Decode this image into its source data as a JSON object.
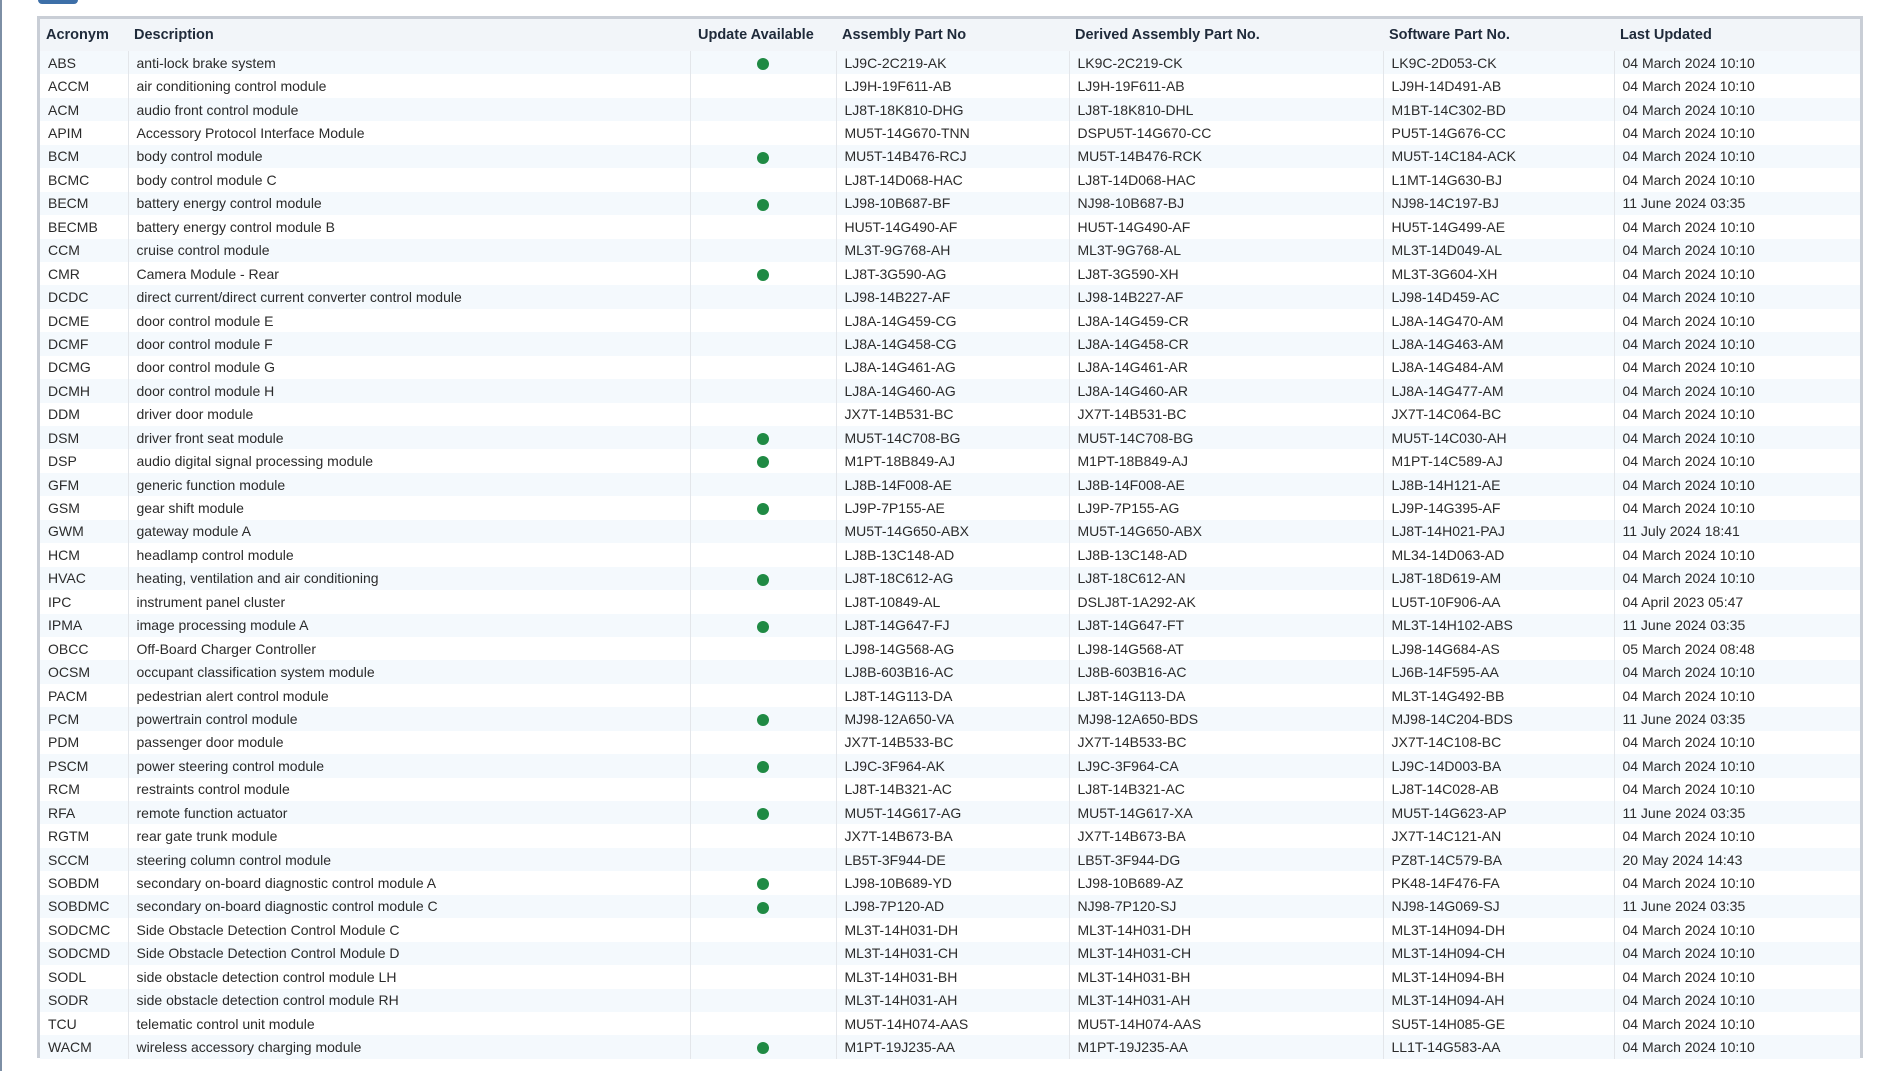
{
  "columns": [
    "Acronym",
    "Description",
    "Update Available",
    "Assembly Part No",
    "Derived Assembly Part No.",
    "Software Part No.",
    "Last Updated"
  ],
  "colors": {
    "update_dot": "#1f8a44",
    "row_stripe": "#f4f9fd",
    "frame": "#c9ced6"
  },
  "rows": [
    {
      "acronym": "ABS",
      "description": "anti-lock brake system",
      "update": true,
      "assembly": "LJ9C-2C219-AK",
      "derived": "LK9C-2C219-CK",
      "software": "LK9C-2D053-CK",
      "updated": "04 March 2024 10:10"
    },
    {
      "acronym": "ACCM",
      "description": "air conditioning control module",
      "update": false,
      "assembly": "LJ9H-19F611-AB",
      "derived": "LJ9H-19F611-AB",
      "software": "LJ9H-14D491-AB",
      "updated": "04 March 2024 10:10"
    },
    {
      "acronym": "ACM",
      "description": "audio front control module",
      "update": false,
      "assembly": "LJ8T-18K810-DHG",
      "derived": "LJ8T-18K810-DHL",
      "software": "M1BT-14C302-BD",
      "updated": "04 March 2024 10:10"
    },
    {
      "acronym": "APIM",
      "description": "Accessory Protocol Interface Module",
      "update": false,
      "assembly": "MU5T-14G670-TNN",
      "derived": "DSPU5T-14G670-CC",
      "software": "PU5T-14G676-CC",
      "updated": "04 March 2024 10:10"
    },
    {
      "acronym": "BCM",
      "description": "body control module",
      "update": true,
      "assembly": "MU5T-14B476-RCJ",
      "derived": "MU5T-14B476-RCK",
      "software": "MU5T-14C184-ACK",
      "updated": "04 March 2024 10:10"
    },
    {
      "acronym": "BCMC",
      "description": "body control module C",
      "update": false,
      "assembly": "LJ8T-14D068-HAC",
      "derived": "LJ8T-14D068-HAC",
      "software": "L1MT-14G630-BJ",
      "updated": "04 March 2024 10:10"
    },
    {
      "acronym": "BECM",
      "description": "battery energy control module",
      "update": true,
      "assembly": "LJ98-10B687-BF",
      "derived": "NJ98-10B687-BJ",
      "software": "NJ98-14C197-BJ",
      "updated": "11 June 2024 03:35"
    },
    {
      "acronym": "BECMB",
      "description": "battery energy control module B",
      "update": false,
      "assembly": "HU5T-14G490-AF",
      "derived": "HU5T-14G490-AF",
      "software": "HU5T-14G499-AE",
      "updated": "04 March 2024 10:10"
    },
    {
      "acronym": "CCM",
      "description": "cruise control module",
      "update": false,
      "assembly": "ML3T-9G768-AH",
      "derived": "ML3T-9G768-AL",
      "software": "ML3T-14D049-AL",
      "updated": "04 March 2024 10:10"
    },
    {
      "acronym": "CMR",
      "description": "Camera Module - Rear",
      "update": true,
      "assembly": "LJ8T-3G590-AG",
      "derived": "LJ8T-3G590-XH",
      "software": "ML3T-3G604-XH",
      "updated": "04 March 2024 10:10"
    },
    {
      "acronym": "DCDC",
      "description": "direct current/direct current converter control module",
      "update": false,
      "assembly": "LJ98-14B227-AF",
      "derived": "LJ98-14B227-AF",
      "software": "LJ98-14D459-AC",
      "updated": "04 March 2024 10:10"
    },
    {
      "acronym": "DCME",
      "description": "door control module E",
      "update": false,
      "assembly": "LJ8A-14G459-CG",
      "derived": "LJ8A-14G459-CR",
      "software": "LJ8A-14G470-AM",
      "updated": "04 March 2024 10:10"
    },
    {
      "acronym": "DCMF",
      "description": "door control module F",
      "update": false,
      "assembly": "LJ8A-14G458-CG",
      "derived": "LJ8A-14G458-CR",
      "software": "LJ8A-14G463-AM",
      "updated": "04 March 2024 10:10"
    },
    {
      "acronym": "DCMG",
      "description": "door control module G",
      "update": false,
      "assembly": "LJ8A-14G461-AG",
      "derived": "LJ8A-14G461-AR",
      "software": "LJ8A-14G484-AM",
      "updated": "04 March 2024 10:10"
    },
    {
      "acronym": "DCMH",
      "description": "door control module H",
      "update": false,
      "assembly": "LJ8A-14G460-AG",
      "derived": "LJ8A-14G460-AR",
      "software": "LJ8A-14G477-AM",
      "updated": "04 March 2024 10:10"
    },
    {
      "acronym": "DDM",
      "description": "driver door module",
      "update": false,
      "assembly": "JX7T-14B531-BC",
      "derived": "JX7T-14B531-BC",
      "software": "JX7T-14C064-BC",
      "updated": "04 March 2024 10:10"
    },
    {
      "acronym": "DSM",
      "description": "driver front seat module",
      "update": true,
      "assembly": "MU5T-14C708-BG",
      "derived": "MU5T-14C708-BG",
      "software": "MU5T-14C030-AH",
      "updated": "04 March 2024 10:10"
    },
    {
      "acronym": "DSP",
      "description": "audio digital signal processing module",
      "update": true,
      "assembly": "M1PT-18B849-AJ",
      "derived": "M1PT-18B849-AJ",
      "software": "M1PT-14C589-AJ",
      "updated": "04 March 2024 10:10"
    },
    {
      "acronym": "GFM",
      "description": "generic function module",
      "update": false,
      "assembly": "LJ8B-14F008-AE",
      "derived": "LJ8B-14F008-AE",
      "software": "LJ8B-14H121-AE",
      "updated": "04 March 2024 10:10"
    },
    {
      "acronym": "GSM",
      "description": "gear shift module",
      "update": true,
      "assembly": "LJ9P-7P155-AE",
      "derived": "LJ9P-7P155-AG",
      "software": "LJ9P-14G395-AF",
      "updated": "04 March 2024 10:10"
    },
    {
      "acronym": "GWM",
      "description": "gateway module A",
      "update": false,
      "assembly": "MU5T-14G650-ABX",
      "derived": "MU5T-14G650-ABX",
      "software": "LJ8T-14H021-PAJ",
      "updated": "11 July 2024 18:41"
    },
    {
      "acronym": "HCM",
      "description": "headlamp control module",
      "update": false,
      "assembly": "LJ8B-13C148-AD",
      "derived": "LJ8B-13C148-AD",
      "software": "ML34-14D063-AD",
      "updated": "04 March 2024 10:10"
    },
    {
      "acronym": "HVAC",
      "description": "heating, ventilation and air conditioning",
      "update": true,
      "assembly": "LJ8T-18C612-AG",
      "derived": "LJ8T-18C612-AN",
      "software": "LJ8T-18D619-AM",
      "updated": "04 March 2024 10:10"
    },
    {
      "acronym": "IPC",
      "description": "instrument panel cluster",
      "update": false,
      "assembly": "LJ8T-10849-AL",
      "derived": "DSLJ8T-1A292-AK",
      "software": "LU5T-10F906-AA",
      "updated": "04 April 2023 05:47"
    },
    {
      "acronym": "IPMA",
      "description": "image processing module A",
      "update": true,
      "assembly": "LJ8T-14G647-FJ",
      "derived": "LJ8T-14G647-FT",
      "software": "ML3T-14H102-ABS",
      "updated": "11 June 2024 03:35"
    },
    {
      "acronym": "OBCC",
      "description": "Off-Board Charger Controller",
      "update": false,
      "assembly": "LJ98-14G568-AG",
      "derived": "LJ98-14G568-AT",
      "software": "LJ98-14G684-AS",
      "updated": "05 March 2024 08:48"
    },
    {
      "acronym": "OCSM",
      "description": "occupant classification system module",
      "update": false,
      "assembly": "LJ8B-603B16-AC",
      "derived": "LJ8B-603B16-AC",
      "software": "LJ6B-14F595-AA",
      "updated": "04 March 2024 10:10"
    },
    {
      "acronym": "PACM",
      "description": "pedestrian alert control module",
      "update": false,
      "assembly": "LJ8T-14G113-DA",
      "derived": "LJ8T-14G113-DA",
      "software": "ML3T-14G492-BB",
      "updated": "04 March 2024 10:10"
    },
    {
      "acronym": "PCM",
      "description": "powertrain control module",
      "update": true,
      "assembly": "MJ98-12A650-VA",
      "derived": "MJ98-12A650-BDS",
      "software": "MJ98-14C204-BDS",
      "updated": "11 June 2024 03:35"
    },
    {
      "acronym": "PDM",
      "description": "passenger door module",
      "update": false,
      "assembly": "JX7T-14B533-BC",
      "derived": "JX7T-14B533-BC",
      "software": "JX7T-14C108-BC",
      "updated": "04 March 2024 10:10"
    },
    {
      "acronym": "PSCM",
      "description": "power steering control module",
      "update": true,
      "assembly": "LJ9C-3F964-AK",
      "derived": "LJ9C-3F964-CA",
      "software": "LJ9C-14D003-BA",
      "updated": "04 March 2024 10:10"
    },
    {
      "acronym": "RCM",
      "description": "restraints control module",
      "update": false,
      "assembly": "LJ8T-14B321-AC",
      "derived": "LJ8T-14B321-AC",
      "software": "LJ8T-14C028-AB",
      "updated": "04 March 2024 10:10"
    },
    {
      "acronym": "RFA",
      "description": "remote function actuator",
      "update": true,
      "assembly": "MU5T-14G617-AG",
      "derived": "MU5T-14G617-XA",
      "software": "MU5T-14G623-AP",
      "updated": "11 June 2024 03:35"
    },
    {
      "acronym": "RGTM",
      "description": "rear gate trunk module",
      "update": false,
      "assembly": "JX7T-14B673-BA",
      "derived": "JX7T-14B673-BA",
      "software": "JX7T-14C121-AN",
      "updated": "04 March 2024 10:10"
    },
    {
      "acronym": "SCCM",
      "description": "steering column control module",
      "update": false,
      "assembly": "LB5T-3F944-DE",
      "derived": "LB5T-3F944-DG",
      "software": "PZ8T-14C579-BA",
      "updated": "20 May 2024 14:43"
    },
    {
      "acronym": "SOBDM",
      "description": "secondary on-board diagnostic control module A",
      "update": true,
      "assembly": "LJ98-10B689-YD",
      "derived": "LJ98-10B689-AZ",
      "software": "PK48-14F476-FA",
      "updated": "04 March 2024 10:10"
    },
    {
      "acronym": "SOBDMC",
      "description": "secondary on-board diagnostic control module C",
      "update": true,
      "assembly": "LJ98-7P120-AD",
      "derived": "NJ98-7P120-SJ",
      "software": "NJ98-14G069-SJ",
      "updated": "11 June 2024 03:35"
    },
    {
      "acronym": "SODCMC",
      "description": "Side Obstacle Detection Control Module C",
      "update": false,
      "assembly": "ML3T-14H031-DH",
      "derived": "ML3T-14H031-DH",
      "software": "ML3T-14H094-DH",
      "updated": "04 March 2024 10:10"
    },
    {
      "acronym": "SODCMD",
      "description": "Side Obstacle Detection Control Module D",
      "update": false,
      "assembly": "ML3T-14H031-CH",
      "derived": "ML3T-14H031-CH",
      "software": "ML3T-14H094-CH",
      "updated": "04 March 2024 10:10"
    },
    {
      "acronym": "SODL",
      "description": "side obstacle detection control module LH",
      "update": false,
      "assembly": "ML3T-14H031-BH",
      "derived": "ML3T-14H031-BH",
      "software": "ML3T-14H094-BH",
      "updated": "04 March 2024 10:10"
    },
    {
      "acronym": "SODR",
      "description": "side obstacle detection control module RH",
      "update": false,
      "assembly": "ML3T-14H031-AH",
      "derived": "ML3T-14H031-AH",
      "software": "ML3T-14H094-AH",
      "updated": "04 March 2024 10:10"
    },
    {
      "acronym": "TCU",
      "description": "telematic control unit module",
      "update": false,
      "assembly": "MU5T-14H074-AAS",
      "derived": "MU5T-14H074-AAS",
      "software": "SU5T-14H085-GE",
      "updated": "04 March 2024 10:10"
    },
    {
      "acronym": "WACM",
      "description": "wireless accessory charging module",
      "update": true,
      "assembly": "M1PT-19J235-AA",
      "derived": "M1PT-19J235-AA",
      "software": "LL1T-14G583-AA",
      "updated": "04 March 2024 10:10"
    }
  ]
}
